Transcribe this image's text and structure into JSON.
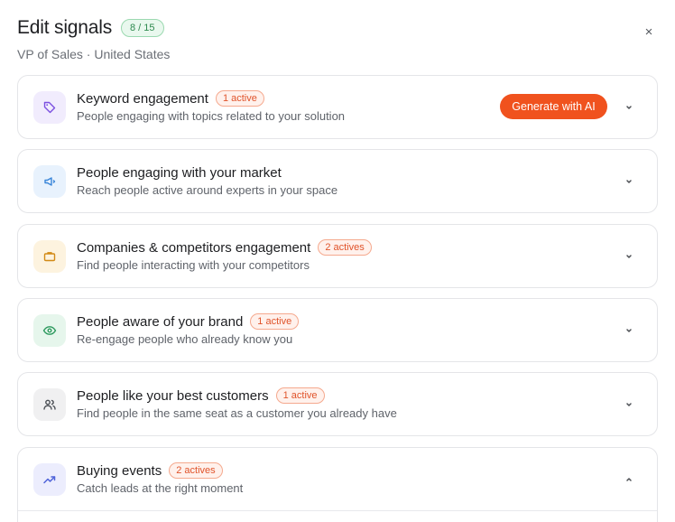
{
  "header": {
    "title": "Edit signals",
    "count_badge": "8 / 15",
    "subtitle": "VP of Sales · United States",
    "close_label": "×"
  },
  "signals": [
    {
      "title": "Keyword engagement",
      "badge": "1 active",
      "description": "People engaging with topics related to your solution",
      "icon": "tag-icon",
      "icon_color": "#7b4fe0",
      "icon_bg": "#f1ecfd",
      "action_label": "Generate with AI",
      "expanded": false
    },
    {
      "title": "People engaging with your market",
      "badge": "",
      "description": "Reach people active around experts in your space",
      "icon": "megaphone-icon",
      "icon_color": "#3a86d9",
      "icon_bg": "#e8f2fd",
      "expanded": false
    },
    {
      "title": "Companies & competitors engagement",
      "badge": "2 actives",
      "description": "Find people interacting with your competitors",
      "icon": "briefcase-icon",
      "icon_color": "#d28a16",
      "icon_bg": "#fdf3df",
      "expanded": false
    },
    {
      "title": "People aware of your brand",
      "badge": "1 active",
      "description": "Re-engage people who already know you",
      "icon": "eye-icon",
      "icon_color": "#2e9a5f",
      "icon_bg": "#e6f6ec",
      "expanded": false
    },
    {
      "title": "People like your best customers",
      "badge": "1 active",
      "description": "Find people in the same seat as a customer you already have",
      "icon": "users-icon",
      "icon_color": "#4b4f55",
      "icon_bg": "#f0f0f1",
      "expanded": false
    },
    {
      "title": "Buying events",
      "badge": "2 actives",
      "description": "Catch leads at the right moment",
      "icon": "trending-up-icon",
      "icon_color": "#4f63d9",
      "icon_bg": "#ecedfd",
      "expanded": true
    }
  ],
  "colors": {
    "accent": "#f0521e",
    "badge_active_text": "#e0532a",
    "count_badge_text": "#2f8a4f"
  }
}
